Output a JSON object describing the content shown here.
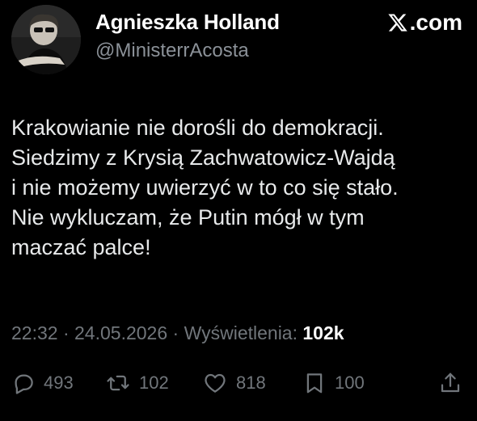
{
  "author": {
    "display_name": "Agnieszka Holland",
    "handle": "@MinisterrAcosta",
    "avatar_icon": "profile-photo"
  },
  "brand": {
    "logo_icon": "x-logo-icon",
    "label": ".com"
  },
  "tweet": {
    "text": "Krakowianie nie dorośli do demokracji.\nSiedzimy z Krysią Zachwatowicz-Wajdą\ni nie możemy uwierzyć w to co się stało.\nNie wykluczam, że Putin mógł w tym\nmaczać palce!"
  },
  "meta": {
    "time": "22:32",
    "separator": " · ",
    "date": "24.05.2026",
    "views_label": "Wyświetlenia:",
    "views_count": "102k"
  },
  "actions": {
    "replies": "493",
    "reposts": "102",
    "likes": "818",
    "bookmarks": "100"
  },
  "colors": {
    "background": "#000000",
    "text": "#e7e9ea",
    "muted": "#71767b",
    "white": "#ffffff"
  }
}
